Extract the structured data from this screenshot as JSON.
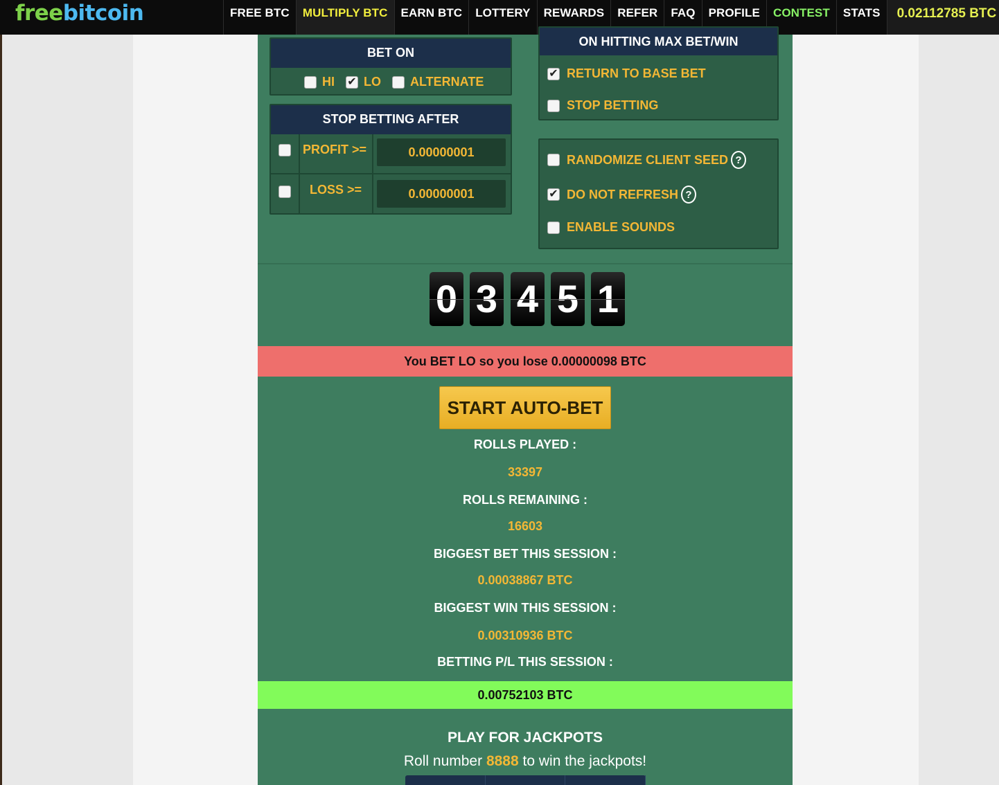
{
  "logo": {
    "part1": "free",
    "part2": "bitcoin"
  },
  "nav": [
    {
      "label": "FREE BTC"
    },
    {
      "label": "MULTIPLY BTC"
    },
    {
      "label": "EARN BTC"
    },
    {
      "label": "LOTTERY"
    },
    {
      "label": "REWARDS"
    },
    {
      "label": "REFER"
    },
    {
      "label": "FAQ"
    },
    {
      "label": "PROFILE"
    },
    {
      "label": "CONTEST"
    },
    {
      "label": "STATS"
    }
  ],
  "balance": "0.02112785 BTC",
  "bet_on": {
    "title": "BET ON",
    "options": [
      {
        "label": "HI",
        "checked": false
      },
      {
        "label": "LO",
        "checked": true
      },
      {
        "label": "ALTERNATE",
        "checked": false
      }
    ]
  },
  "stop_betting_after": {
    "title": "STOP BETTING AFTER",
    "profit": {
      "label": "PROFIT >=",
      "value": "0.00000001",
      "checked": false
    },
    "loss": {
      "label": "LOSS >=",
      "value": "0.00000001",
      "checked": false
    }
  },
  "max_bet_win": {
    "title": "ON HITTING MAX BET/WIN",
    "options": [
      {
        "label": "RETURN TO BASE BET",
        "checked": true
      },
      {
        "label": "STOP BETTING",
        "checked": false
      }
    ]
  },
  "settings": {
    "randomize_seed": {
      "label": "RANDOMIZE CLIENT SEED",
      "checked": false
    },
    "do_not_refresh": {
      "label": "DO NOT REFRESH",
      "checked": true
    },
    "enable_sounds": {
      "label": "ENABLE SOUNDS",
      "checked": false
    },
    "help_glyph": "?"
  },
  "roll_digits": [
    "0",
    "3",
    "4",
    "5",
    "1"
  ],
  "result_message": "You BET LO so you lose 0.00000098 BTC",
  "start_button": "START AUTO-BET",
  "stats": {
    "rolls_played_label": "ROLLS PLAYED :",
    "rolls_played": "33397",
    "rolls_remaining_label": "ROLLS REMAINING :",
    "rolls_remaining": "16603",
    "biggest_bet_label": "BIGGEST BET THIS SESSION :",
    "biggest_bet": "0.00038867 BTC",
    "biggest_win_label": "BIGGEST WIN THIS SESSION :",
    "biggest_win": "0.00310936 BTC",
    "pl_label": "BETTING P/L THIS SESSION :",
    "pl_value": "0.00752103 BTC"
  },
  "jackpot": {
    "title": "PLAY FOR JACKPOTS",
    "text_before": "Roll number",
    "number": "8888",
    "text_after": "to win the jackpots!"
  },
  "colors": {
    "table_green": "#3e7d5f",
    "panel_header": "#1c2f4a",
    "accent_gold": "#f3b735",
    "lose_red": "#ee6f6c",
    "profit_green": "#82fb5a",
    "nav_active": "#f2ee3d",
    "nav_contest": "#88f266"
  }
}
